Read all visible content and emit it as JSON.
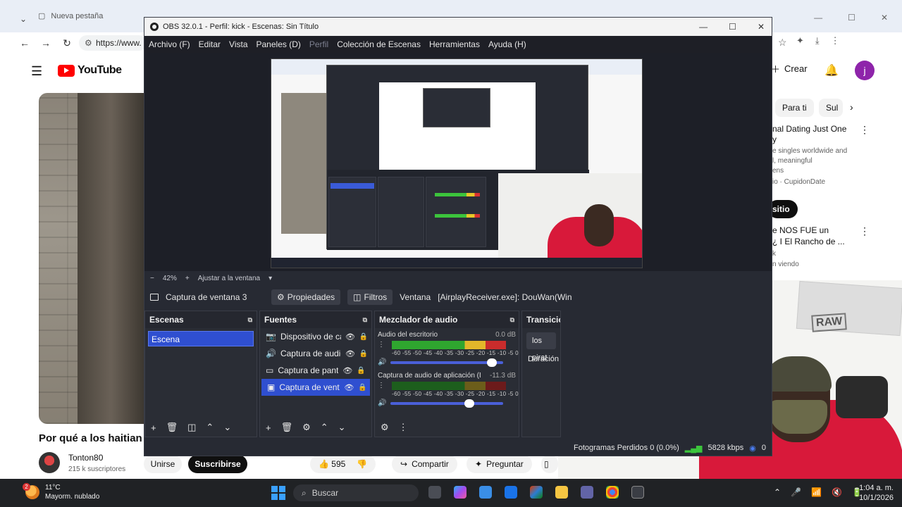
{
  "browser": {
    "tab_label": "Nueva pestaña",
    "url": "https://www.",
    "window_controls": [
      "—",
      "☐",
      "✕"
    ]
  },
  "youtube": {
    "logo_text": "YouTube",
    "create_label": "Crear",
    "user_initial": "j",
    "video_title": "Por qué a los haitian",
    "channel_name": "Tonton80",
    "subscribers": "215 k suscriptores",
    "join_label": "Unirse",
    "subscribe_label": "Suscribirse",
    "like_count": "595",
    "share_label": "Compartir",
    "ask_label": "Preguntar",
    "chips": [
      "Para ti",
      "Sul"
    ],
    "sidebar": {
      "item1_title": "nal Dating Just One",
      "item1_title2": "y",
      "item1_meta1": "e singles worldwide and",
      "item1_meta2": "l, meaningful",
      "item1_meta3": "ens",
      "item1_sponsor": "io · CupidonDate",
      "sitio_label": "sitio",
      "item2_title": "e NOS FUE un",
      "item2_title2": "¿ I El Rancho de ...",
      "item2_meta1": "k",
      "item2_meta2": "n viendo"
    }
  },
  "obs": {
    "title": "OBS 32.0.1 - Perfil: kick - Escenas: Sin Título",
    "menu": [
      "Archivo (F)",
      "Editar",
      "Vista",
      "Paneles (D)",
      "Perfil",
      "Colección de Escenas",
      "Herramientas",
      "Ayuda (H)"
    ],
    "zoom": "42%",
    "fit_label": "Ajustar a la ventana",
    "source_name": "Captura de ventana 3",
    "properties_label": "Propiedades",
    "filters_label": "Filtros",
    "window_label": "Ventana",
    "window_value": "[AirplayReceiver.exe]: DouWan(Win",
    "docks": {
      "scenes_title": "Escenas",
      "scene_item": "Escena",
      "sources_title": "Fuentes",
      "sources": [
        "Dispositivo de ca",
        "Captura de audic",
        "Captura de pante",
        "Captura de venta"
      ],
      "mixer_title": "Mezclador de audio",
      "channel1_name": "Audio del escritorio",
      "channel1_db": "0.0 dB",
      "channel2_name": "Captura de audio de aplicación (B",
      "channel2_db": "-11.3 dB",
      "meter_scale": "-60 -55 -50 -45 -40 -35 -30 -25 -20 -15 -10  -5   0",
      "channel1_level": 0.9,
      "channel2_level": 0.7,
      "transitions_title": "Transicio",
      "transition_value": "los pirat",
      "duration_label": "Duración"
    },
    "status": {
      "dropped": "Fotogramas Perdidos 0 (0.0%)",
      "kbps": "5828 kbps",
      "extra": "0"
    }
  },
  "taskbar": {
    "temp": "11°C",
    "weather": "Mayorm. nublado",
    "weather_badge": "2",
    "search_placeholder": "Buscar",
    "time": "1:04 a. m.",
    "date": "10/1/2026"
  }
}
